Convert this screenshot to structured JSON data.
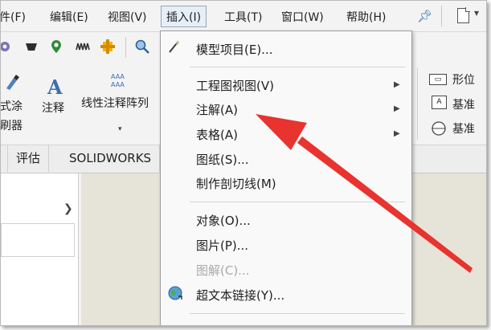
{
  "menubar": {
    "items": [
      "文件(F)",
      "编辑(E)",
      "视图(V)",
      "插入(I)",
      "工具(T)",
      "窗口(W)",
      "帮助(H)"
    ],
    "first_visible": "件(F)",
    "pin_icon": "pin-icon"
  },
  "ribbon": {
    "left_tool": [
      "式涂",
      "刷器"
    ],
    "annotation": "注释",
    "linear_pattern": "线性注释阵列",
    "linear_pattern_visible": "线性注释阵列",
    "grid_glyph": "AAA\nAAA",
    "right_tools": [
      "形位",
      "基准",
      "基准"
    ]
  },
  "tabs": [
    "评估",
    "SOLIDWORKS"
  ],
  "dropdown": {
    "items": [
      {
        "label": "模型项目(E)...",
        "icon": "model-items-icon",
        "submenu": false,
        "disabled": false
      },
      {
        "label": "工程图视图(V)",
        "submenu": true,
        "disabled": false
      },
      {
        "label": "注解(A)",
        "submenu": true,
        "disabled": false
      },
      {
        "label": "表格(A)",
        "submenu": true,
        "disabled": false
      },
      {
        "label": "图纸(S)...",
        "submenu": false,
        "disabled": false
      },
      {
        "label": "制作剖切线(M)",
        "submenu": false,
        "disabled": false
      },
      {
        "label": "对象(O)...",
        "submenu": false,
        "disabled": false
      },
      {
        "label": "图片(P)...",
        "submenu": false,
        "disabled": false
      },
      {
        "label": "图解(C)...",
        "submenu": false,
        "disabled": true
      },
      {
        "label": "超文本链接(Y)...",
        "icon": "hyperlink-globe-icon",
        "submenu": false,
        "disabled": false
      }
    ]
  },
  "colors": {
    "annotation_arrow": "#e8332f",
    "menu_active_bg": "#e6eef8",
    "accent_blue": "#3b6fb0"
  }
}
